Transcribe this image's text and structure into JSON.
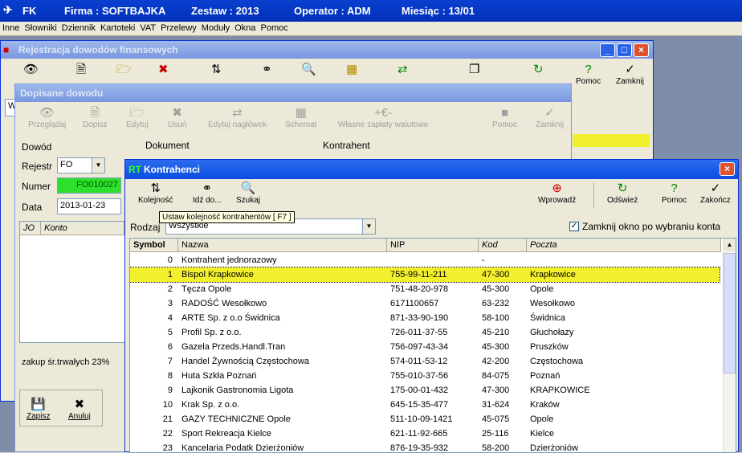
{
  "app": {
    "name": "FK",
    "firma": "Firma : SOFTBAJKA",
    "zestaw": "Zestaw : 2013",
    "operator": "Operator : ADM",
    "miesiac": "Miesiąc : 13/01"
  },
  "menu": [
    "Inne",
    "Słowniki",
    "Dziennik",
    "Kartoteki",
    "VAT",
    "Przelewy",
    "Moduły",
    "Okna",
    "Pomoc"
  ],
  "rej": {
    "title": "Rejestracja dowodów finansowych",
    "pomoc": "Pomoc",
    "zamknij": "Zamknij",
    "field_w": "W"
  },
  "dop": {
    "title": "Dopisane dowodu",
    "toolbar": [
      "Przeglądaj",
      "Dopisz",
      "Edytuj",
      "Usuń",
      "Edytuj nagłówek",
      "Schemat",
      "Własne zapłaty walutowe",
      "Pomoc",
      "Zamknij"
    ],
    "dowod": "Dowód",
    "dokument": "Dokument",
    "kontrahent": "Kontrahent",
    "rejestr_label": "Rejestr",
    "rejestr_value": "FO",
    "numer_label": "Numer",
    "numer_value": "FO010027",
    "data_label": "Data",
    "data_value": "2013-01-23",
    "col_jo": "JO",
    "col_konto": "Konto",
    "footer_text": "zakup śr.trwałych 23%",
    "zapisz": "Zapisz",
    "anuluj": "Anuluj"
  },
  "kon": {
    "title": "Kontrahenci",
    "title_prefix": "RT",
    "toolbar": {
      "kolejnosc": "Kolejność",
      "idz": "Idź do...",
      "szukaj": "Szukaj",
      "wprowadz": "Wprowadź",
      "odswiez": "Odśwież",
      "pomoc": "Pomoc",
      "zakoncz": "Zakończ"
    },
    "tooltip": "Ustaw kolejność kontrahentów [ F7 ]",
    "rodzaj_label": "Rodzaj",
    "rodzaj_value": "Wszystkie",
    "zamknij_check": "Zamknij okno po wybraniu konta",
    "columns": [
      "Symbol",
      "Nazwa",
      "NIP",
      "Kod",
      "Poczta"
    ],
    "rows": [
      {
        "symbol": "0",
        "nazwa": "Kontrahent jednorazowy",
        "nip": "",
        "kod": "-",
        "poczta": ""
      },
      {
        "symbol": "1",
        "nazwa": "Bispol Krapkowice",
        "nip": "755-99-11-211",
        "kod": "47-300",
        "poczta": "Krapkowice"
      },
      {
        "symbol": "2",
        "nazwa": "Tęcza Opole",
        "nip": "751-48-20-978",
        "kod": "45-300",
        "poczta": "Opole"
      },
      {
        "symbol": "3",
        "nazwa": "RADOŚĆ  Wesołkowo",
        "nip": "6171100657",
        "kod": "63-232",
        "poczta": "Wesołkowo"
      },
      {
        "symbol": "4",
        "nazwa": "ARTE Sp. z o.o Świdnica",
        "nip": "871-33-90-190",
        "kod": "58-100",
        "poczta": "Świdnica"
      },
      {
        "symbol": "5",
        "nazwa": "Profil Sp. z o.o.",
        "nip": "726-011-37-55",
        "kod": "45-210",
        "poczta": "Głuchołazy"
      },
      {
        "symbol": "6",
        "nazwa": "Gazela  Przeds.Handl.Tran",
        "nip": "756-097-43-34",
        "kod": "45-300",
        "poczta": "Pruszków"
      },
      {
        "symbol": "7",
        "nazwa": "Handel Żywnością Częstochowa",
        "nip": "574-011-53-12",
        "kod": "42-200",
        "poczta": "Częstochowa"
      },
      {
        "symbol": "8",
        "nazwa": "Huta Szkła Poznań",
        "nip": "755-010-37-56",
        "kod": "84-075",
        "poczta": "Poznań"
      },
      {
        "symbol": "9",
        "nazwa": "Lajkonik  Gastronomia Ligota",
        "nip": "175-00-01-432",
        "kod": "47-300",
        "poczta": "KRAPKOWICE"
      },
      {
        "symbol": "10",
        "nazwa": "Krak Sp. z o.o.",
        "nip": "645-15-35-477",
        "kod": "31-624",
        "poczta": "Kraków"
      },
      {
        "symbol": "21",
        "nazwa": "GAZY TECHNICZNE Opole",
        "nip": "511-10-09-1421",
        "kod": "45-075",
        "poczta": "Opole"
      },
      {
        "symbol": "22",
        "nazwa": "Sport Rekreacja   Kielce",
        "nip": "621-11-92-665",
        "kod": "25-116",
        "poczta": "Kielce"
      },
      {
        "symbol": "23",
        "nazwa": "Kancelaria Podatk Dzierżoniów",
        "nip": "876-19-35-932",
        "kod": "58-200",
        "poczta": "Dzierżoniów"
      }
    ]
  }
}
